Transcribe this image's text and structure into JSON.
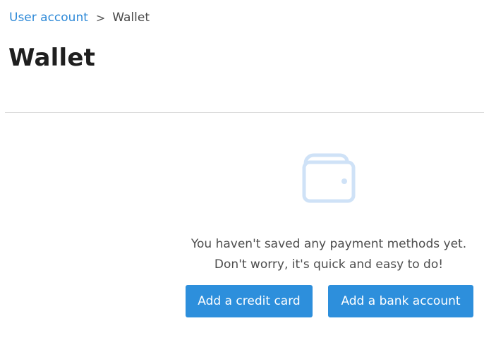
{
  "breadcrumb": {
    "parent": "User account",
    "separator": ">",
    "current": "Wallet"
  },
  "page": {
    "title": "Wallet"
  },
  "empty_state": {
    "icon": "wallet-icon",
    "line1": "You haven't saved any payment methods yet.",
    "line2": "Don't worry, it's quick and easy to do!"
  },
  "actions": {
    "add_card_label": "Add a credit card",
    "add_bank_label": "Add a bank account"
  },
  "colors": {
    "accent": "#2d8fdc",
    "link": "#2f8ad8",
    "icon": "#cfe2f7"
  }
}
